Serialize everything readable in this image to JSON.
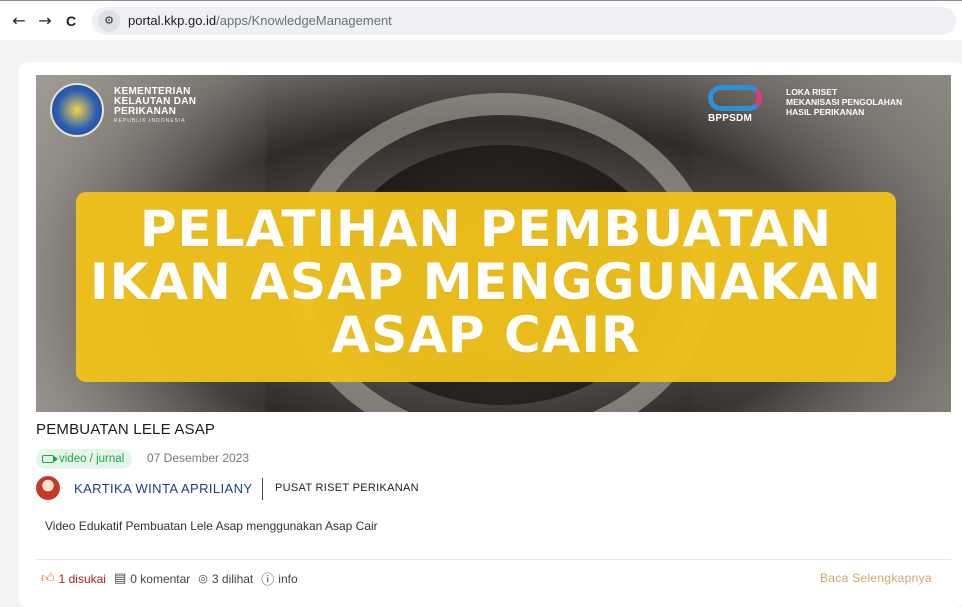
{
  "browser": {
    "back_icon": "←",
    "forward_icon": "→",
    "reload_icon": "C",
    "site_info_icon": "site-settings",
    "url_host": "portal.kkp.go.id",
    "url_path": "/apps/KnowledgeManagement"
  },
  "banner": {
    "logo_left_lines": [
      "KEMENTERIAN",
      "KELAUTAN DAN",
      "PERIKANAN"
    ],
    "logo_left_sub": "REPUBLIK INDONESIA",
    "logo_right_mark": "BPPSDM",
    "logo_right_lines": [
      "LOKA RISET",
      "MEKANISASI PENGOLAHAN",
      "HASIL PERIKANAN"
    ],
    "headline_lines": [
      "PELATIHAN PEMBUATAN",
      "IKAN ASAP MENGGUNAKAN",
      "ASAP CAIR"
    ],
    "colors": {
      "headline_box": "#f0c21c",
      "headline_text": "#ffffff"
    }
  },
  "post": {
    "title": "PEMBUATAN LELE ASAP",
    "type_badge": "video / jurnal",
    "date": "07 Desember 2023",
    "author": "KARTIKA WINTA APRILIANY",
    "organization": "PUSAT RISET PERIKANAN",
    "description": "Video Edukatif Pembuatan Lele Asap menggunakan Asap Cair"
  },
  "actions": {
    "likes": "1 disukai",
    "comments": "0 komentar",
    "views": "3 dilihat",
    "info": "info",
    "read_more": "Baca Selengkapnya"
  }
}
